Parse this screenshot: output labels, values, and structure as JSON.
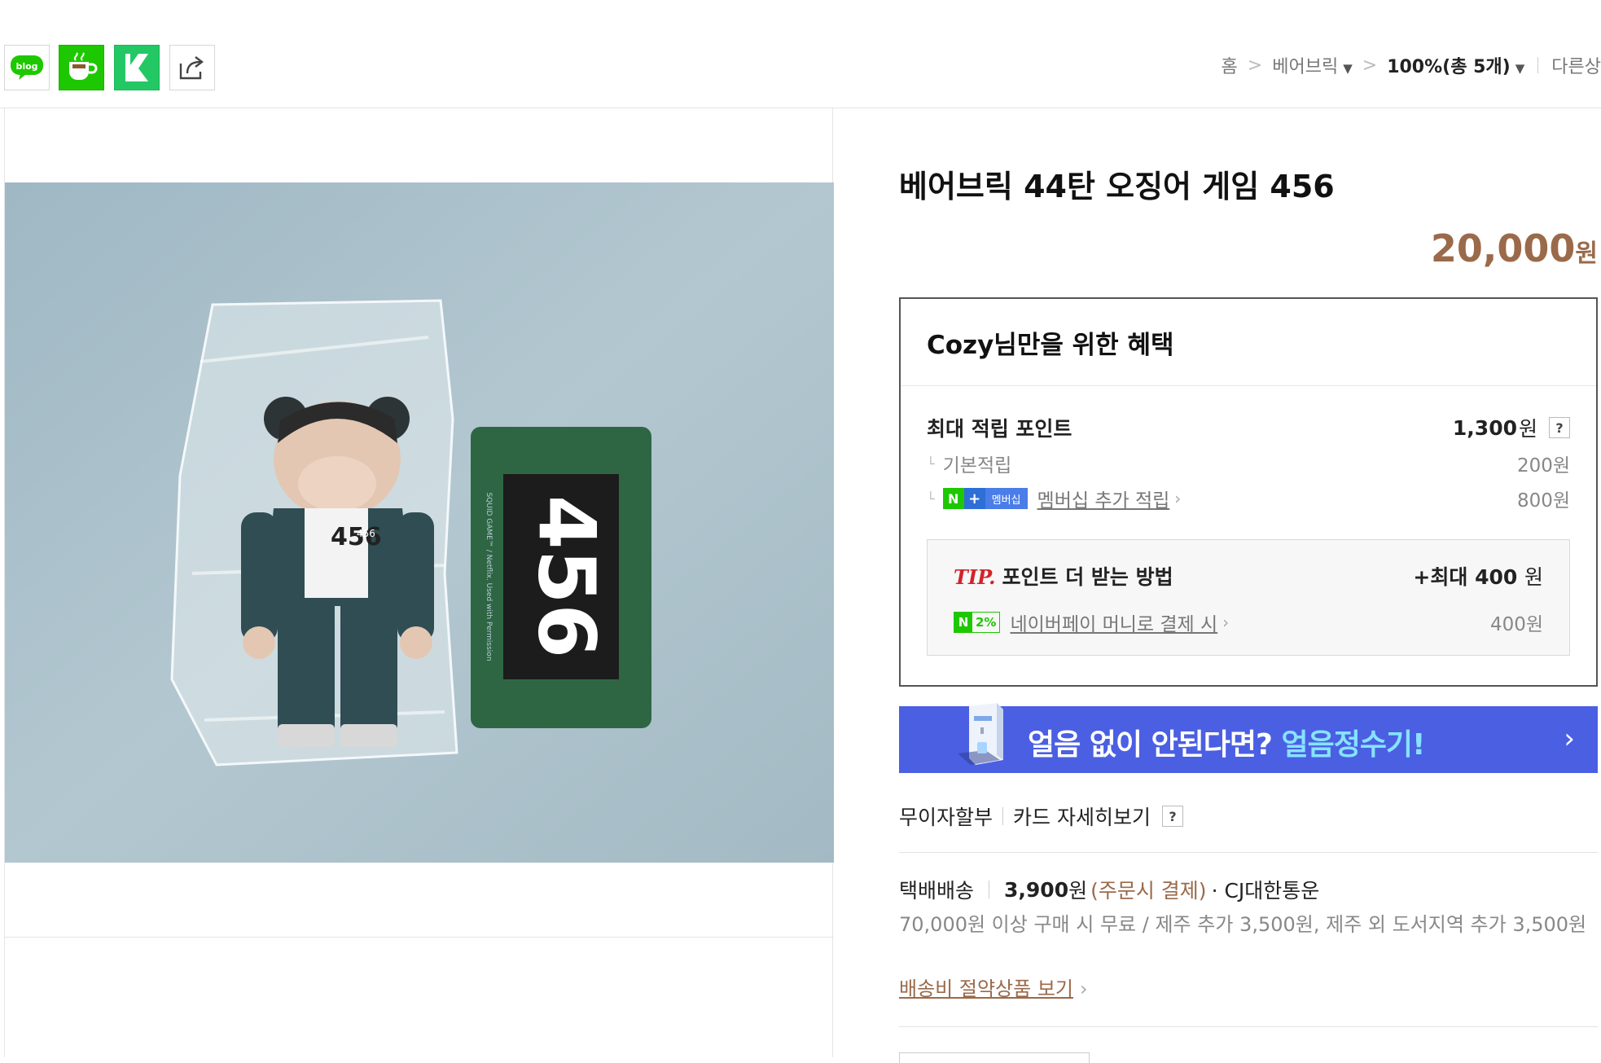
{
  "share": {
    "blog_label": "blog",
    "icons": [
      "blog-icon",
      "cafe-icon",
      "band-icon",
      "share-icon"
    ]
  },
  "breadcrumb": {
    "home": "홈",
    "sep": ">",
    "category": "베어브릭",
    "percent": "100%(총 5개)",
    "other": "다른상"
  },
  "product": {
    "title": "베어브릭 44탄 오징어 게임 456",
    "price": "20,000",
    "price_unit": "원"
  },
  "benefit": {
    "heading": "Cozy님만을 위한 혜택",
    "max_points_label": "최대 적립 포인트",
    "max_points_value": "1,300",
    "unit": "원",
    "help": "?",
    "basic_label": "기본적립",
    "basic_value": "200원",
    "membership_badge": "멤버십",
    "membership_label": "멤버십 추가 적립",
    "membership_value": "800원",
    "tip_word": "TIP.",
    "tip_label": "포인트 더 받는 방법",
    "tip_amount_prefix": "+최대",
    "tip_amount": "400",
    "tip_unit": "원",
    "npay_badge": "2%",
    "npay_label": "네이버페이 머니로 결제 시",
    "npay_value": "400원"
  },
  "banner": {
    "text_main": "얼음 없이 안된다면? ",
    "text_highlight": "얼음정수기!",
    "arrow": "›"
  },
  "payment": {
    "installment": "무이자할부",
    "card_detail": "카드 자세히보기",
    "help": "?"
  },
  "shipping": {
    "method": "택배배송",
    "fee": "3,900",
    "fee_unit": "원",
    "fee_note": "(주문시 결제)",
    "courier": "· CJ대한통운",
    "policy": "70,000원 이상 구매 시 무료 / 제주 추가 3,500원, 제주 외 도서지역 추가 3,500원",
    "saver_link": "배송비 절약상품 보기"
  },
  "colors": {
    "price": "#9a6a4a",
    "naver_green": "#1ec800",
    "banner_bg": "#4b5fe3",
    "banner_highlight": "#86e3ff",
    "tip_red": "#d2232a"
  }
}
